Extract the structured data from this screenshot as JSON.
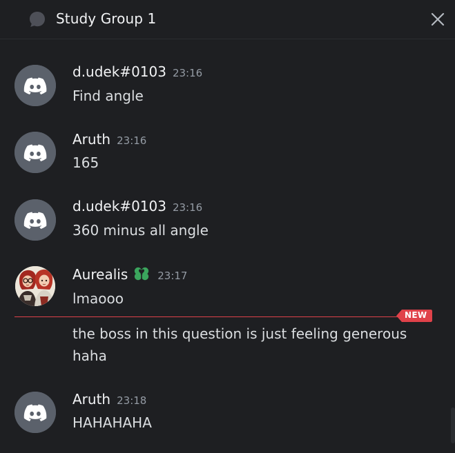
{
  "header": {
    "title": "Study Group 1",
    "thread_icon": "thread-bubble-icon",
    "close_icon": "close-icon"
  },
  "messages": [
    {
      "username": "d.udek#0103",
      "time": "23:16",
      "text": "Find angle",
      "avatar": "discord-default-avatar"
    },
    {
      "username": "Aruth",
      "time": "23:16",
      "text": "165",
      "avatar": "discord-default-avatar"
    },
    {
      "username": "d.udek#0103",
      "time": "23:16",
      "text": "360 minus all angle",
      "avatar": "discord-default-avatar"
    },
    {
      "username": "Aurealis",
      "time": "23:17",
      "text": "lmaooo",
      "avatar": "custom-avatar",
      "badge": "clover-badge-icon"
    },
    {
      "text": "the boss in this question is just feeling generous haha"
    },
    {
      "username": "Aruth",
      "time": "23:18",
      "text": "HAHAHAHA",
      "avatar": "discord-default-avatar"
    }
  ],
  "divider": {
    "label": "NEW"
  },
  "colors": {
    "background": "#1e1f22",
    "avatar_bg": "#5b616b",
    "timestamp": "#949ba4",
    "new_accent": "#e0424a",
    "clover": "#3ba55d"
  }
}
